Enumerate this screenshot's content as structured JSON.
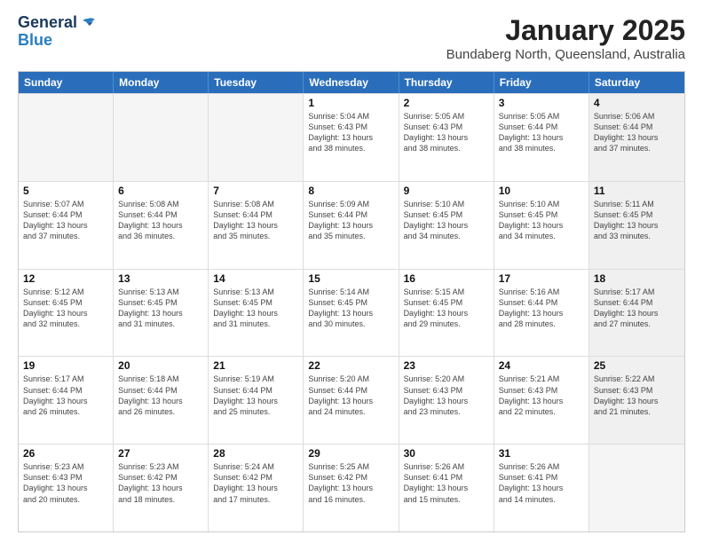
{
  "header": {
    "logo_general": "General",
    "logo_blue": "Blue",
    "month": "January 2025",
    "location": "Bundaberg North, Queensland, Australia"
  },
  "weekdays": [
    "Sunday",
    "Monday",
    "Tuesday",
    "Wednesday",
    "Thursday",
    "Friday",
    "Saturday"
  ],
  "weeks": [
    [
      {
        "day": "",
        "text": "",
        "shaded": false,
        "empty": true
      },
      {
        "day": "",
        "text": "",
        "shaded": false,
        "empty": true
      },
      {
        "day": "",
        "text": "",
        "shaded": false,
        "empty": true
      },
      {
        "day": "1",
        "text": "Sunrise: 5:04 AM\nSunset: 6:43 PM\nDaylight: 13 hours\nand 38 minutes.",
        "shaded": false,
        "empty": false
      },
      {
        "day": "2",
        "text": "Sunrise: 5:05 AM\nSunset: 6:43 PM\nDaylight: 13 hours\nand 38 minutes.",
        "shaded": false,
        "empty": false
      },
      {
        "day": "3",
        "text": "Sunrise: 5:05 AM\nSunset: 6:44 PM\nDaylight: 13 hours\nand 38 minutes.",
        "shaded": false,
        "empty": false
      },
      {
        "day": "4",
        "text": "Sunrise: 5:06 AM\nSunset: 6:44 PM\nDaylight: 13 hours\nand 37 minutes.",
        "shaded": true,
        "empty": false
      }
    ],
    [
      {
        "day": "5",
        "text": "Sunrise: 5:07 AM\nSunset: 6:44 PM\nDaylight: 13 hours\nand 37 minutes.",
        "shaded": false,
        "empty": false
      },
      {
        "day": "6",
        "text": "Sunrise: 5:08 AM\nSunset: 6:44 PM\nDaylight: 13 hours\nand 36 minutes.",
        "shaded": false,
        "empty": false
      },
      {
        "day": "7",
        "text": "Sunrise: 5:08 AM\nSunset: 6:44 PM\nDaylight: 13 hours\nand 35 minutes.",
        "shaded": false,
        "empty": false
      },
      {
        "day": "8",
        "text": "Sunrise: 5:09 AM\nSunset: 6:44 PM\nDaylight: 13 hours\nand 35 minutes.",
        "shaded": false,
        "empty": false
      },
      {
        "day": "9",
        "text": "Sunrise: 5:10 AM\nSunset: 6:45 PM\nDaylight: 13 hours\nand 34 minutes.",
        "shaded": false,
        "empty": false
      },
      {
        "day": "10",
        "text": "Sunrise: 5:10 AM\nSunset: 6:45 PM\nDaylight: 13 hours\nand 34 minutes.",
        "shaded": false,
        "empty": false
      },
      {
        "day": "11",
        "text": "Sunrise: 5:11 AM\nSunset: 6:45 PM\nDaylight: 13 hours\nand 33 minutes.",
        "shaded": true,
        "empty": false
      }
    ],
    [
      {
        "day": "12",
        "text": "Sunrise: 5:12 AM\nSunset: 6:45 PM\nDaylight: 13 hours\nand 32 minutes.",
        "shaded": false,
        "empty": false
      },
      {
        "day": "13",
        "text": "Sunrise: 5:13 AM\nSunset: 6:45 PM\nDaylight: 13 hours\nand 31 minutes.",
        "shaded": false,
        "empty": false
      },
      {
        "day": "14",
        "text": "Sunrise: 5:13 AM\nSunset: 6:45 PM\nDaylight: 13 hours\nand 31 minutes.",
        "shaded": false,
        "empty": false
      },
      {
        "day": "15",
        "text": "Sunrise: 5:14 AM\nSunset: 6:45 PM\nDaylight: 13 hours\nand 30 minutes.",
        "shaded": false,
        "empty": false
      },
      {
        "day": "16",
        "text": "Sunrise: 5:15 AM\nSunset: 6:45 PM\nDaylight: 13 hours\nand 29 minutes.",
        "shaded": false,
        "empty": false
      },
      {
        "day": "17",
        "text": "Sunrise: 5:16 AM\nSunset: 6:44 PM\nDaylight: 13 hours\nand 28 minutes.",
        "shaded": false,
        "empty": false
      },
      {
        "day": "18",
        "text": "Sunrise: 5:17 AM\nSunset: 6:44 PM\nDaylight: 13 hours\nand 27 minutes.",
        "shaded": true,
        "empty": false
      }
    ],
    [
      {
        "day": "19",
        "text": "Sunrise: 5:17 AM\nSunset: 6:44 PM\nDaylight: 13 hours\nand 26 minutes.",
        "shaded": false,
        "empty": false
      },
      {
        "day": "20",
        "text": "Sunrise: 5:18 AM\nSunset: 6:44 PM\nDaylight: 13 hours\nand 26 minutes.",
        "shaded": false,
        "empty": false
      },
      {
        "day": "21",
        "text": "Sunrise: 5:19 AM\nSunset: 6:44 PM\nDaylight: 13 hours\nand 25 minutes.",
        "shaded": false,
        "empty": false
      },
      {
        "day": "22",
        "text": "Sunrise: 5:20 AM\nSunset: 6:44 PM\nDaylight: 13 hours\nand 24 minutes.",
        "shaded": false,
        "empty": false
      },
      {
        "day": "23",
        "text": "Sunrise: 5:20 AM\nSunset: 6:43 PM\nDaylight: 13 hours\nand 23 minutes.",
        "shaded": false,
        "empty": false
      },
      {
        "day": "24",
        "text": "Sunrise: 5:21 AM\nSunset: 6:43 PM\nDaylight: 13 hours\nand 22 minutes.",
        "shaded": false,
        "empty": false
      },
      {
        "day": "25",
        "text": "Sunrise: 5:22 AM\nSunset: 6:43 PM\nDaylight: 13 hours\nand 21 minutes.",
        "shaded": true,
        "empty": false
      }
    ],
    [
      {
        "day": "26",
        "text": "Sunrise: 5:23 AM\nSunset: 6:43 PM\nDaylight: 13 hours\nand 20 minutes.",
        "shaded": false,
        "empty": false
      },
      {
        "day": "27",
        "text": "Sunrise: 5:23 AM\nSunset: 6:42 PM\nDaylight: 13 hours\nand 18 minutes.",
        "shaded": false,
        "empty": false
      },
      {
        "day": "28",
        "text": "Sunrise: 5:24 AM\nSunset: 6:42 PM\nDaylight: 13 hours\nand 17 minutes.",
        "shaded": false,
        "empty": false
      },
      {
        "day": "29",
        "text": "Sunrise: 5:25 AM\nSunset: 6:42 PM\nDaylight: 13 hours\nand 16 minutes.",
        "shaded": false,
        "empty": false
      },
      {
        "day": "30",
        "text": "Sunrise: 5:26 AM\nSunset: 6:41 PM\nDaylight: 13 hours\nand 15 minutes.",
        "shaded": false,
        "empty": false
      },
      {
        "day": "31",
        "text": "Sunrise: 5:26 AM\nSunset: 6:41 PM\nDaylight: 13 hours\nand 14 minutes.",
        "shaded": false,
        "empty": false
      },
      {
        "day": "",
        "text": "",
        "shaded": true,
        "empty": true
      }
    ]
  ]
}
